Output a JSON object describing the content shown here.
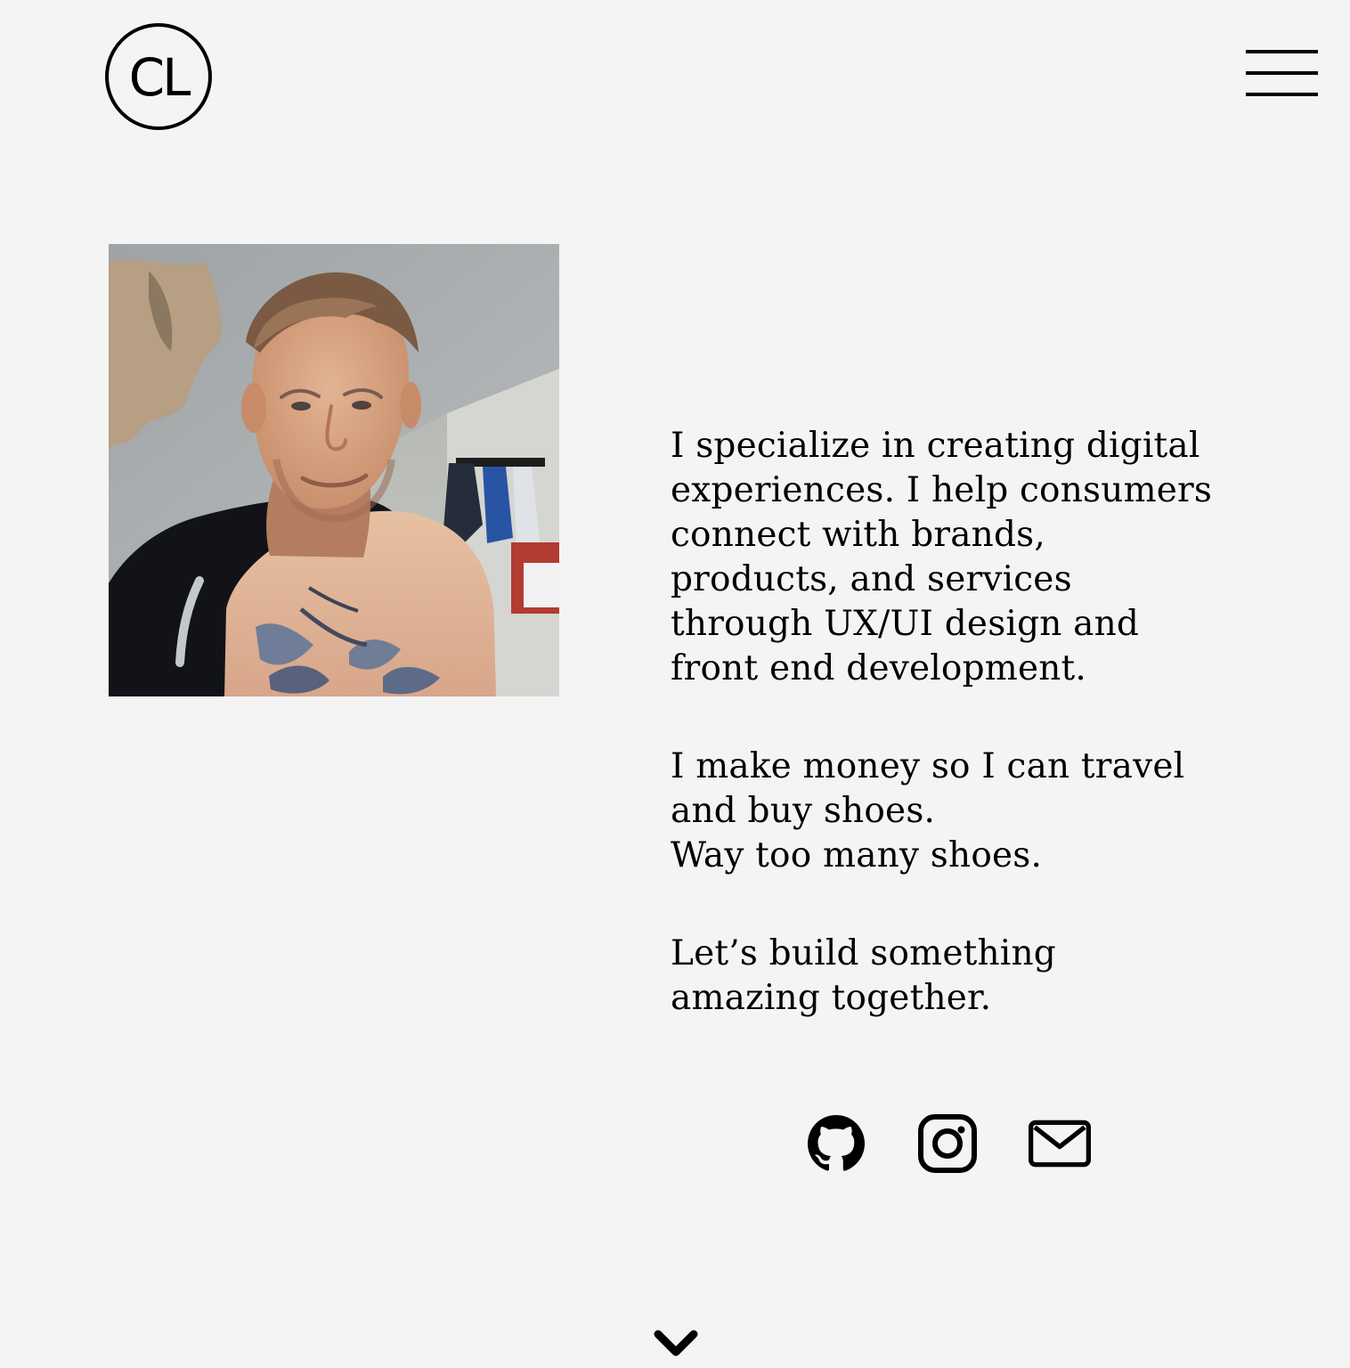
{
  "header": {
    "logo_text": "CL",
    "menu_icon": "hamburger-menu-icon"
  },
  "profile": {
    "photo_icon": "portrait-photo"
  },
  "bio": {
    "paragraphs": [
      {
        "lines": [
          "I specialize in creating digital",
          "experiences. I help consumers",
          "connect with brands,",
          "products, and services",
          "through UX/UI design and",
          "front end development."
        ]
      },
      {
        "lines": [
          "I make money so I can travel",
          "and buy shoes.",
          "Way too many shoes."
        ]
      },
      {
        "lines": [
          "Let’s build something",
          "amazing together."
        ]
      }
    ]
  },
  "social": [
    {
      "name": "github",
      "icon": "github-icon"
    },
    {
      "name": "instagram",
      "icon": "instagram-icon"
    },
    {
      "name": "email",
      "icon": "mail-icon"
    }
  ],
  "scroll_indicator": {
    "icon": "chevron-down-icon"
  },
  "colors": {
    "background": "#f4f4f4",
    "text": "#000000"
  }
}
